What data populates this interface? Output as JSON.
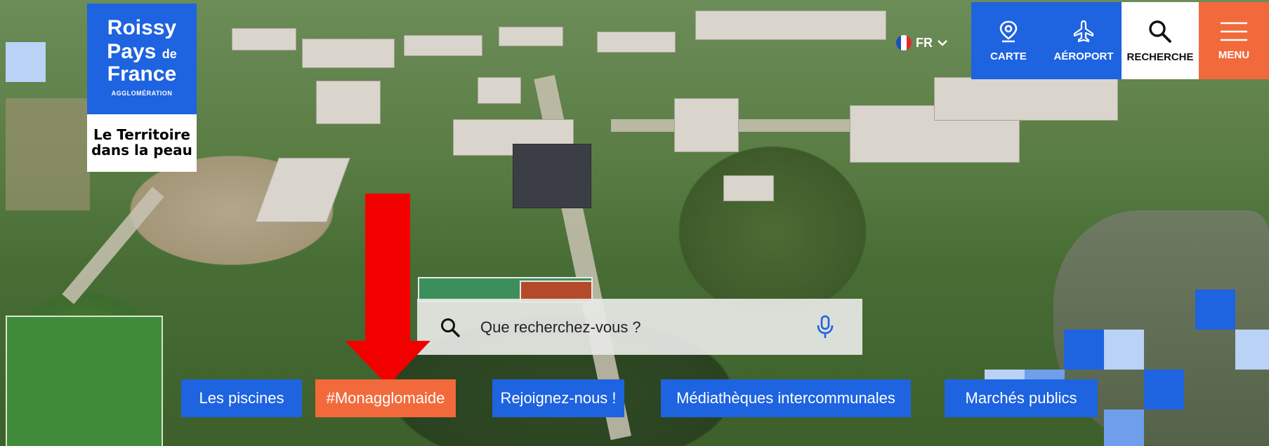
{
  "logo": {
    "line1": "Roissy",
    "line2": "Pays",
    "line2_small": "de",
    "line3": "France",
    "line4": "AGGLOMÉRATION",
    "slogan1": "Le Territoire",
    "slogan2": "dans la peau"
  },
  "language": {
    "current": "FR"
  },
  "topnav": [
    {
      "label": "CARTE",
      "icon": "map-pin-icon"
    },
    {
      "label": "AÉROPORT",
      "icon": "airplane-icon"
    },
    {
      "label": "RECHERCHE",
      "icon": "search-icon"
    },
    {
      "label": "MENU",
      "icon": "hamburger-icon"
    }
  ],
  "search": {
    "placeholder": "Que recherchez-vous ?"
  },
  "quick_links": [
    "Les piscines",
    "#Monagglomaide",
    "Rejoignez-nous !",
    "Médiathèques intercommunales",
    "Marchés publics"
  ],
  "colors": {
    "brand_blue": "#1e63e0",
    "accent_orange": "#f26a3c",
    "arrow_red": "#f20000",
    "light_blue": "#b9d2f6"
  }
}
